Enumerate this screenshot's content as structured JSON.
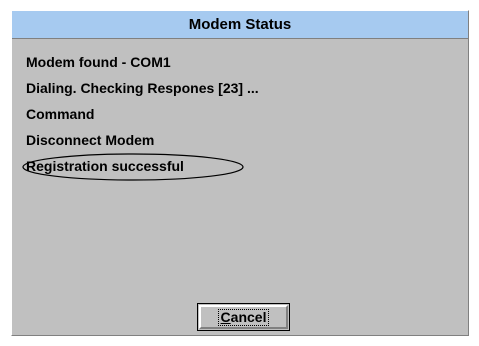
{
  "window": {
    "title": "Modem Status"
  },
  "status": {
    "lines": [
      "Modem found - COM1",
      "Dialing. Checking Respones [23] ...",
      "Command",
      "Disconnect Modem",
      "Registration successful"
    ]
  },
  "buttons": {
    "cancel": {
      "mnemonic": "C",
      "rest": "ancel"
    }
  },
  "colors": {
    "title_bar": "#a6caf0",
    "dialog_face": "#c0c0c0"
  }
}
